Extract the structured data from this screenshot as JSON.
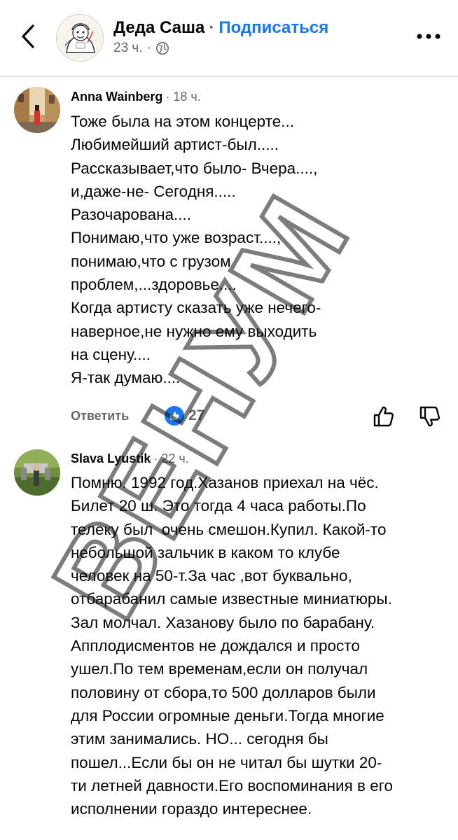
{
  "header": {
    "page_name": "Деда Саша",
    "separator": "·",
    "subscribe_label": "Подписаться",
    "post_time": "23 ч.",
    "privacy_icon": "globe-icon"
  },
  "comments": [
    {
      "author": "Anna Wainberg",
      "time": "· 18 ч.",
      "text": "Тоже была на этом концерте...\nЛюбимейший артист-был.....\nРассказывает,что было- Вчера....,\nи,даже-не- Сегодня.....\nРазочарована....\nПонимаю,что уже возраст....,\nпонимаю,что с грузом\nпроблем,...здоровье....\nКогда артисту сказать уже нечего-\nнаверное,не нужно ему выходить\nна сцену....\nЯ-так думаю....",
      "reply_label": "Ответить",
      "reaction_icon": "like-icon",
      "reaction_count": "27"
    },
    {
      "author": "Slava Lyustik",
      "time": "· 22 ч.",
      "text": "Помню. 1992 год.Хазанов приехал на чёс.\nБилет 20 ш. Это тогда 4 часа работы.По\nтелеку был  очень смешон.Купил. Какой-то\nнебольшой зальчик в каком то клубе\nчеловек на 50-т.За час ,вот буквально,\nотбарабанил самые известные миниатюры.\nЗал молчал. Хазанову было по барабану.\nАпплодисментов не дождался и просто\nушел.По тем временам,если он получал\nполовину от сбора,то 500 долларов были\nдля России огромные деньги.Тогда многие\nэтим занимались. НО... сегодня бы\nпошел...Если бы он не читал бы шутки 20-\nти летней давности.Его воспоминания в его\nисполнении гораздо интереснее."
    }
  ],
  "watermark_text": "ВЕНУМ",
  "colors": {
    "accent": "#1877f2",
    "secondary_text": "#65676b",
    "divider": "#e4e6eb"
  }
}
